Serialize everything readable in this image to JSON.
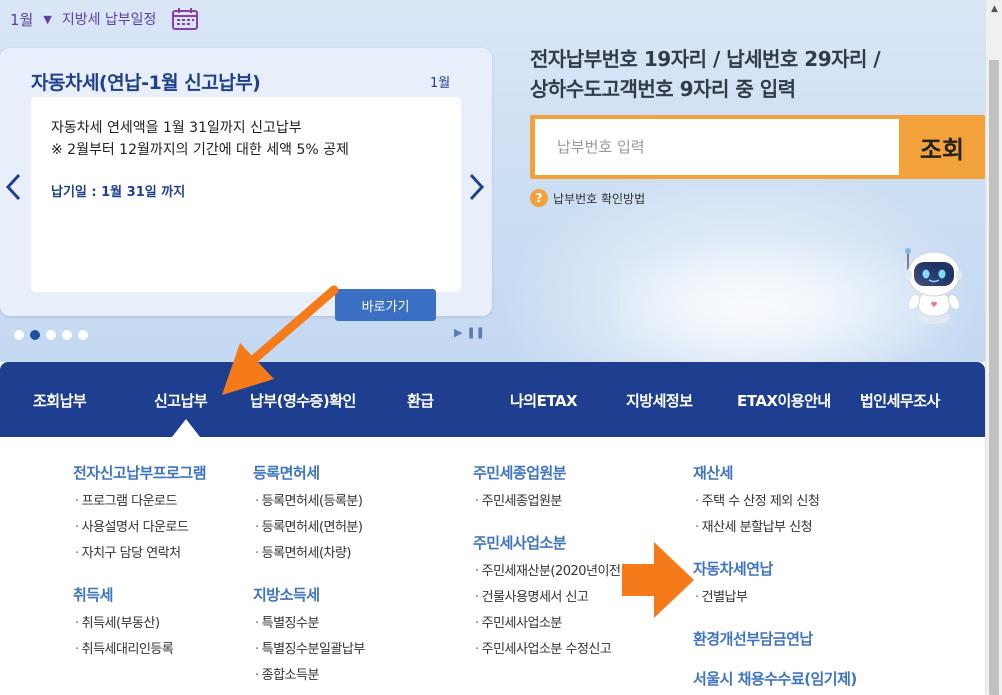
{
  "schedule": {
    "month": "1월",
    "label": "지방세 납부일정"
  },
  "card": {
    "title": "자동차세(연납-1월 신고납부)",
    "month": "1월",
    "desc1": "자동차세 연세액을 1월 31일까지 신고납부",
    "desc2": "※ 2월부터 12월까지의 기간에 대한 세액 5% 공제",
    "due": "납기일 : 1월 31일 까지",
    "button": "바로가기"
  },
  "search": {
    "title_line1": "전자납부번호 19자리 / 납세번호 29자리 /",
    "title_line2": "상하수도고객번호 9자리 중 입력",
    "placeholder": "납부번호 입력",
    "button": "조회",
    "help": "납부번호 확인방법"
  },
  "nav": {
    "items": [
      "조회납부",
      "신고납부",
      "납부(영수증)확인",
      "환급",
      "나의ETAX",
      "지방세정보",
      "ETAX이용안내",
      "법인세무조사"
    ]
  },
  "menu": {
    "col1": {
      "t1": "전자신고납부프로그램",
      "s1": [
        "프로그램 다운로드",
        "사용설명서 다운로드",
        "자치구 담당 연락처"
      ],
      "t2": "취득세",
      "s2": [
        "취득세(부동산)",
        "취득세대리인등록"
      ]
    },
    "col2": {
      "t1": "등록면허세",
      "s1": [
        "등록면허세(등록분)",
        "등록면허세(면허분)",
        "등록면허세(차량)"
      ],
      "t2": "지방소득세",
      "s2": [
        "특별징수분",
        "특별징수분일괄납부",
        "종합소득분"
      ]
    },
    "col3": {
      "t1": "주민세종업원분",
      "s1": [
        "주민세종업원분"
      ],
      "t2": "주민세사업소분",
      "s2": [
        "주민세재산분(2020년이전",
        "건물사용명세서 신고",
        "주민세사업소분",
        "주민세사업소분 수정신고"
      ]
    },
    "col4": {
      "t1": "재산세",
      "s1": [
        "주택 수 산정 제외 신청",
        "재산세 분할납부 신청"
      ],
      "t2": "자동차세연납",
      "s2": [
        "건별납부"
      ],
      "t3": "환경개선부담금연납",
      "t4": "서울시 채용수수료(임기제)"
    }
  },
  "colors": {
    "navy": "#1e3f8f",
    "accent_orange": "#f3a13a",
    "link_blue": "#3f74c2"
  }
}
